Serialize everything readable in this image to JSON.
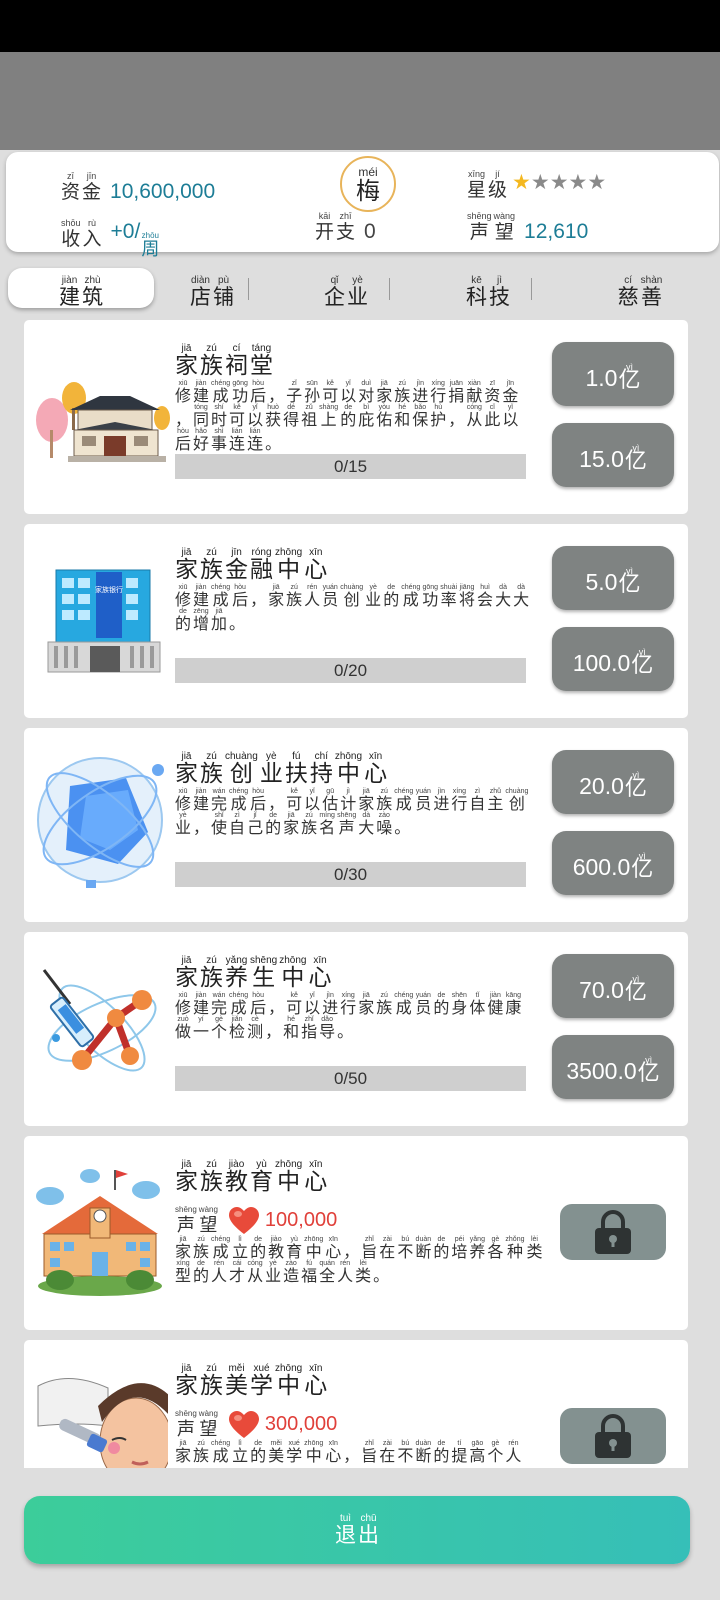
{
  "stats": {
    "funds": {
      "label": [
        {
          "c": "资",
          "p": "zī"
        },
        {
          "c": "金",
          "p": "jīn"
        }
      ],
      "value": "10,600,000"
    },
    "income": {
      "label": [
        {
          "c": "收",
          "p": "shōu"
        },
        {
          "c": "入",
          "p": "rù"
        }
      ],
      "value": "+0/",
      "unit": {
        "c": "周",
        "p": "zhōu"
      }
    },
    "rank": {
      "char": "梅",
      "pinyin": "méi"
    },
    "expense": {
      "label": [
        {
          "c": "开",
          "p": "kāi"
        },
        {
          "c": "支",
          "p": "zhī"
        }
      ],
      "value": "0"
    },
    "star_level": {
      "label": [
        {
          "c": "星",
          "p": "xīng"
        },
        {
          "c": "级",
          "p": "jí"
        }
      ],
      "stars": 5,
      "filled": 1
    },
    "reputation": {
      "label": [
        {
          "c": "声",
          "p": "shēng"
        },
        {
          "c": "望",
          "p": "wàng"
        }
      ],
      "value": "12,610"
    }
  },
  "tabs": [
    {
      "chars": [
        {
          "c": "建",
          "p": "jiàn"
        },
        {
          "c": "筑",
          "p": "zhù"
        }
      ],
      "active": true
    },
    {
      "chars": [
        {
          "c": "店",
          "p": "diàn"
        },
        {
          "c": "铺",
          "p": "pù"
        }
      ],
      "active": false
    },
    {
      "chars": [
        {
          "c": "企",
          "p": "qǐ"
        },
        {
          "c": "业",
          "p": "yè"
        }
      ],
      "active": false
    },
    {
      "chars": [
        {
          "c": "科",
          "p": "kē"
        },
        {
          "c": "技",
          "p": "jì"
        }
      ],
      "active": false
    },
    {
      "chars": [
        {
          "c": "慈",
          "p": "cí"
        },
        {
          "c": "善",
          "p": "shàn"
        }
      ],
      "active": false
    }
  ],
  "unit": {
    "c": "亿",
    "p": "yì"
  },
  "cards": [
    {
      "icon": "ancestral-hall-icon",
      "title": [
        {
          "c": "家",
          "p": "jiā"
        },
        {
          "c": "族",
          "p": "zú"
        },
        {
          "c": "祠",
          "p": "cí"
        },
        {
          "c": "堂",
          "p": "táng"
        }
      ],
      "desc": "xiū:修 jiàn:建 chéng:成 gōng:功 hòu:后 :， zǐ:子 sūn:孙 kě:可 yǐ:以 duì:对 jiā:家 zú:族 jìn:进 xíng:行 juān:捐 xiàn:献 zī:资 jīn:金 :， tóng:同 shí:时 kě:可 yǐ:以 huò:获 dé:得 zǔ:祖 shàng:上 de:的 bì:庇 yòu:佑 hé:和 bǎo:保 hù:护 :， cóng:从 cǐ:此 yǐ:以 hòu:后 hǎo:好 shì:事 lián:连 lián:连 :。",
      "progress_text": "0/15",
      "progress": 0,
      "costs": [
        "1.0",
        "15.0"
      ]
    },
    {
      "icon": "bank-building-icon",
      "sign": "家族银行",
      "title": [
        {
          "c": "家",
          "p": "jiā"
        },
        {
          "c": "族",
          "p": "zú"
        },
        {
          "c": "金",
          "p": "jīn"
        },
        {
          "c": "融",
          "p": "róng"
        },
        {
          "c": "中",
          "p": "zhōng"
        },
        {
          "c": "心",
          "p": "xīn"
        }
      ],
      "desc": "xiū:修 jiàn:建 chéng:成 hòu:后 :， jiā:家 zú:族 rén:人 yuán:员 chuàng:创 yè:业 de:的 chéng:成 gōng:功 shuài:率 jiāng:将 huì:会 dà:大 dà:大 de:的 zēng:增 jiā:加 :。",
      "progress_text": "0/20",
      "progress": 0,
      "costs": [
        "5.0",
        "100.0"
      ]
    },
    {
      "icon": "blue-orb-icon",
      "title": [
        {
          "c": "家",
          "p": "jiā"
        },
        {
          "c": "族",
          "p": "zú"
        },
        {
          "c": "创",
          "p": "chuàng"
        },
        {
          "c": "业",
          "p": "yè"
        },
        {
          "c": "扶",
          "p": "fú"
        },
        {
          "c": "持",
          "p": "chí"
        },
        {
          "c": "中",
          "p": "zhōng"
        },
        {
          "c": "心",
          "p": "xīn"
        }
      ],
      "desc": "xiū:修 jiàn:建 wán:完 chéng:成 hòu:后 :， kě:可 yǐ:以 gū:估 jì:计 jiā:家 zú:族 chéng:成 yuán:员 jìn:进 xíng:行 zì:自 zhǔ:主 chuàng:创 yè:业 :， shǐ:使 zì:自 jǐ:己 de:的 jiā:家 zú:族 míng:名 shēng:声 dà:大 zào:噪 :。",
      "progress_text": "0/30",
      "progress": 0,
      "costs": [
        "20.0",
        "600.0"
      ]
    },
    {
      "icon": "molecule-syringe-icon",
      "title": [
        {
          "c": "家",
          "p": "jiā"
        },
        {
          "c": "族",
          "p": "zú"
        },
        {
          "c": "养",
          "p": "yǎng"
        },
        {
          "c": "生",
          "p": "shēng"
        },
        {
          "c": "中",
          "p": "zhōng"
        },
        {
          "c": "心",
          "p": "xīn"
        }
      ],
      "desc": "xiū:修 jiàn:建 wán:完 chéng:成 hòu:后 :， kě:可 yǐ:以 jìn:进 xíng:行 jiā:家 zú:族 chéng:成 yuán:员 de:的 shēn:身 tǐ:体 jiàn:健 kāng:康 zuò:做 yí:一 gè:个 jiǎn:检 cè:测 :， hé:和 zhǐ:指 dǎo:导 :。",
      "progress_text": "0/50",
      "progress": 0,
      "costs": [
        "70.0",
        "3500.0"
      ]
    },
    {
      "icon": "school-building-icon",
      "locked": true,
      "title": [
        {
          "c": "家",
          "p": "jiā"
        },
        {
          "c": "族",
          "p": "zú"
        },
        {
          "c": "教",
          "p": "jiào"
        },
        {
          "c": "育",
          "p": "yù"
        },
        {
          "c": "中",
          "p": "zhōng"
        },
        {
          "c": "心",
          "p": "xīn"
        }
      ],
      "rep_label": [
        {
          "c": "声",
          "p": "shēng"
        },
        {
          "c": "望",
          "p": "wàng"
        }
      ],
      "rep_value": "100,000",
      "desc": "jiā:家 zú:族 chéng:成 lì:立 de:的 jiào:教 yù:育 zhōng:中 xīn:心 :， zhǐ:旨 zài:在 bú:不 duàn:断 de:的 péi:培 yǎng:养 gè:各 zhǒng:种 lèi:类 xíng:型 de:的 rén:人 cái:才 cóng:从 yè:业 zào:造 fú:福 quán:全 rén:人 lèi:类 :。"
    },
    {
      "icon": "beauty-treatment-icon",
      "locked": true,
      "title": [
        {
          "c": "家",
          "p": "jiā"
        },
        {
          "c": "族",
          "p": "zú"
        },
        {
          "c": "美",
          "p": "měi"
        },
        {
          "c": "学",
          "p": "xué"
        },
        {
          "c": "中",
          "p": "zhōng"
        },
        {
          "c": "心",
          "p": "xīn"
        }
      ],
      "rep_label": [
        {
          "c": "声",
          "p": "shēng"
        },
        {
          "c": "望",
          "p": "wàng"
        }
      ],
      "rep_value": "300,000",
      "desc": "jiā:家 zú:族 chéng:成 lì:立 de:的 měi:美 xué:学 zhōng:中 xīn:心 :， zhǐ:旨 zài:在 bú:不 duàn:断 de:的 tí:提 gāo:高 gè:个 rén:人"
    }
  ],
  "exit": [
    {
      "c": "退",
      "p": "tuì"
    },
    {
      "c": "出",
      "p": "chū"
    }
  ]
}
